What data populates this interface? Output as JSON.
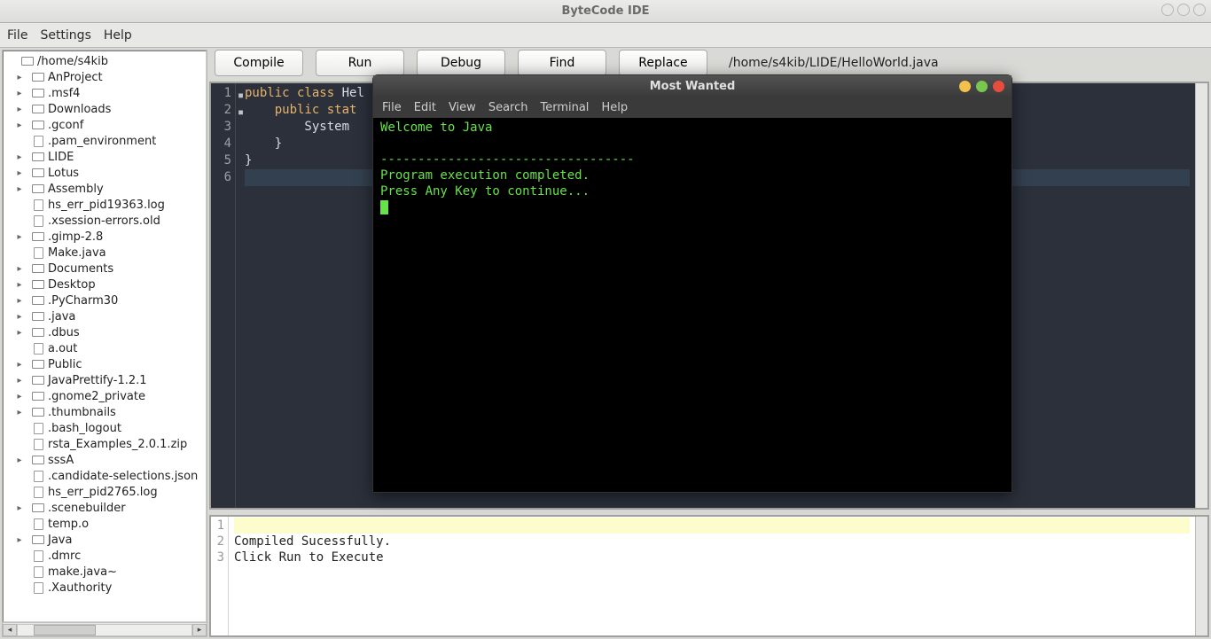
{
  "window": {
    "title": "ByteCode IDE"
  },
  "menu": {
    "items": [
      "File",
      "Settings",
      "Help"
    ]
  },
  "toolbar": {
    "compile": "Compile",
    "run": "Run",
    "debug": "Debug",
    "find": "Find",
    "replace": "Replace",
    "path": "/home/s4kib/LIDE/HelloWorld.java"
  },
  "tree": {
    "root": "/home/s4kib",
    "items": [
      {
        "type": "folder",
        "expand": true,
        "name": "AnProject"
      },
      {
        "type": "folder",
        "expand": true,
        "name": ".msf4"
      },
      {
        "type": "folder",
        "expand": true,
        "name": "Downloads"
      },
      {
        "type": "folder",
        "expand": true,
        "name": ".gconf"
      },
      {
        "type": "file",
        "name": ".pam_environment"
      },
      {
        "type": "folder",
        "expand": true,
        "name": "LIDE"
      },
      {
        "type": "folder",
        "expand": true,
        "name": "Lotus"
      },
      {
        "type": "folder",
        "expand": true,
        "name": "Assembly"
      },
      {
        "type": "file",
        "name": "hs_err_pid19363.log"
      },
      {
        "type": "file",
        "name": ".xsession-errors.old"
      },
      {
        "type": "folder",
        "expand": true,
        "name": ".gimp-2.8"
      },
      {
        "type": "file",
        "name": "Make.java"
      },
      {
        "type": "folder",
        "expand": true,
        "name": "Documents"
      },
      {
        "type": "folder",
        "expand": true,
        "name": "Desktop"
      },
      {
        "type": "folder",
        "expand": true,
        "name": ".PyCharm30"
      },
      {
        "type": "folder",
        "expand": true,
        "name": ".java"
      },
      {
        "type": "folder",
        "expand": true,
        "name": ".dbus"
      },
      {
        "type": "file",
        "name": "a.out"
      },
      {
        "type": "folder",
        "expand": true,
        "name": "Public"
      },
      {
        "type": "folder",
        "expand": true,
        "name": "JavaPrettify-1.2.1"
      },
      {
        "type": "folder",
        "expand": true,
        "name": ".gnome2_private"
      },
      {
        "type": "folder",
        "expand": true,
        "name": ".thumbnails"
      },
      {
        "type": "file",
        "name": ".bash_logout"
      },
      {
        "type": "file",
        "name": "rsta_Examples_2.0.1.zip"
      },
      {
        "type": "folder",
        "expand": true,
        "name": "sssA"
      },
      {
        "type": "file",
        "name": ".candidate-selections.json"
      },
      {
        "type": "file",
        "name": "hs_err_pid2765.log"
      },
      {
        "type": "folder",
        "expand": true,
        "name": ".scenebuilder"
      },
      {
        "type": "file",
        "name": "temp.o"
      },
      {
        "type": "folder",
        "expand": true,
        "name": "Java"
      },
      {
        "type": "file",
        "name": ".dmrc"
      },
      {
        "type": "file",
        "name": "make.java~"
      },
      {
        "type": "file",
        "name": ".Xauthority"
      }
    ]
  },
  "editor": {
    "lines": [
      {
        "n": "1",
        "kw": "public class",
        "rest": " Hel",
        "mark": true
      },
      {
        "n": "2",
        "kw": "    public stat",
        "rest": "",
        "mark": true
      },
      {
        "n": "3",
        "kw": "",
        "rest": "        System"
      },
      {
        "n": "4",
        "kw": "",
        "rest": "    }"
      },
      {
        "n": "5",
        "kw": "",
        "rest": "}"
      },
      {
        "n": "6",
        "kw": "",
        "rest": "",
        "hl": true
      }
    ]
  },
  "output": {
    "lines": [
      {
        "n": "1",
        "text": ""
      },
      {
        "n": "2",
        "text": "Compiled Sucessfully."
      },
      {
        "n": "3",
        "text": "Click Run to Execute"
      }
    ]
  },
  "terminal": {
    "title": "Most Wanted",
    "menu": [
      "File",
      "Edit",
      "View",
      "Search",
      "Terminal",
      "Help"
    ],
    "welcome": "Welcome to Java",
    "sep": "----------------------------------",
    "done": "Program execution completed.",
    "press": "Press Any Key to continue...",
    "dot_colors": {
      "min": "#f4c24c",
      "max": "#78c850",
      "close": "#e84c3d"
    }
  }
}
